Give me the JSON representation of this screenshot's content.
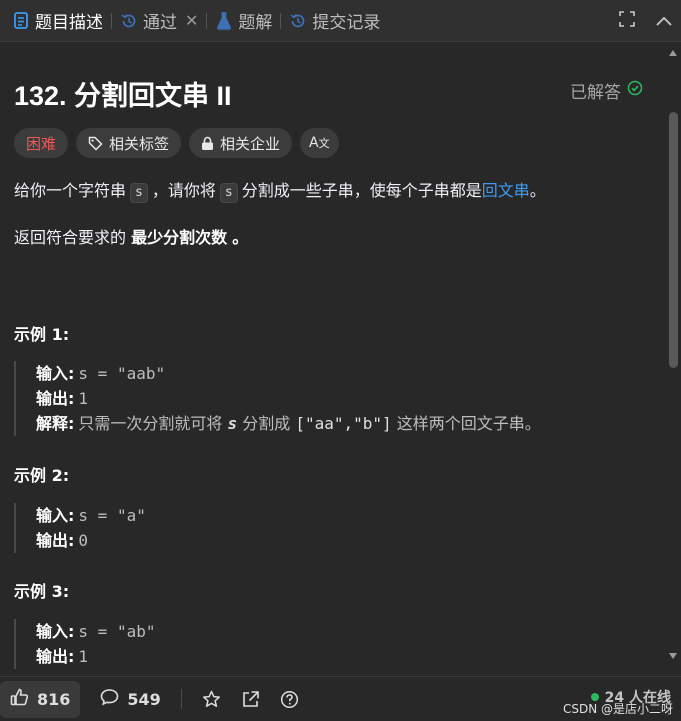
{
  "tabs": [
    {
      "label": "题目描述",
      "icon": "document-icon"
    },
    {
      "label": "通过",
      "icon": "history-icon"
    },
    {
      "label": "题解",
      "icon": "flask-icon"
    },
    {
      "label": "提交记录",
      "icon": "history-icon"
    }
  ],
  "problem": {
    "title": "132. 分割回文串 II",
    "status": "已解答",
    "tags": [
      "困难",
      "相关标签",
      "相关企业"
    ],
    "desc1_a": "给你一个字符串",
    "desc1_code1": "s",
    "desc1_b": "，请你将",
    "desc1_code2": "s",
    "desc1_c": "分割成一些子串，使每个子串都是",
    "desc1_link": "回文串",
    "desc1_d": "。",
    "desc2_a": "返回符合要求的",
    "desc2_bold": "最少分割次数",
    "desc2_b": "。"
  },
  "examples": [
    {
      "title": "示例 1:",
      "input_label": "输入:",
      "input": "s = \"aab\"",
      "output_label": "输出:",
      "output": "1",
      "explain_label": "解释:",
      "explain_a": "只需一次分割就可将",
      "explain_s": "s",
      "explain_b": "分割成",
      "explain_code": "[\"aa\",\"b\"]",
      "explain_c": "这样两个回文子串。"
    },
    {
      "title": "示例 2:",
      "input_label": "输入:",
      "input": "s = \"a\"",
      "output_label": "输出:",
      "output": "0"
    },
    {
      "title": "示例 3:",
      "input_label": "输入:",
      "input": "s = \"ab\"",
      "output_label": "输出:",
      "output": "1"
    }
  ],
  "bottom": {
    "likes": "816",
    "comments": "549",
    "online": "24 人在线"
  },
  "watermark": "CSDN @是店小二呀",
  "colors": {
    "accent": "#3c9bf4",
    "hard": "#f4574f",
    "solved": "#2cbb5d"
  }
}
